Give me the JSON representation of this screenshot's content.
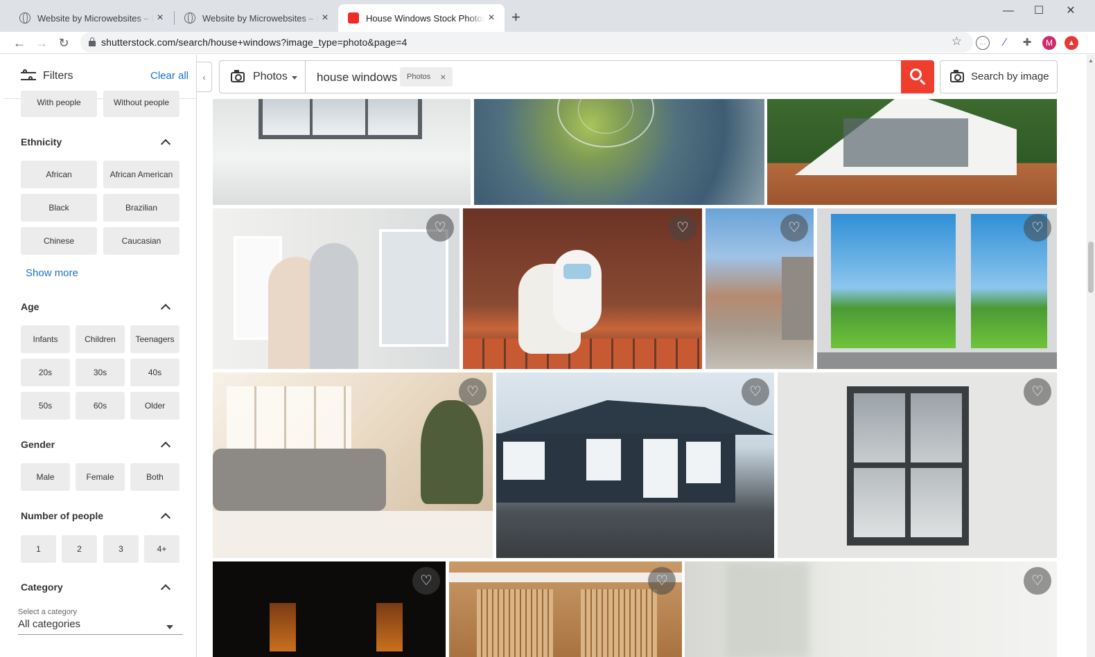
{
  "browser": {
    "tabs": [
      {
        "title": "Website by Microwebsites – Perth",
        "active": false
      },
      {
        "title": "Website by Microwebsites – Perth",
        "active": false
      },
      {
        "title": "House Windows Stock Photos, Images",
        "active": true
      }
    ],
    "url": "shutterstock.com/search/house+windows?image_type=photo&page=4",
    "profile_initial": "M"
  },
  "filters": {
    "label": "Filters",
    "clear_all": "Clear all",
    "people_chips": [
      "With people",
      "Without people"
    ],
    "ethnicity": {
      "title": "Ethnicity",
      "chips": [
        "African",
        "African American",
        "Black",
        "Brazilian",
        "Chinese",
        "Caucasian"
      ],
      "show_more": "Show more"
    },
    "age": {
      "title": "Age",
      "chips": [
        "Infants",
        "Children",
        "Teenagers",
        "20s",
        "30s",
        "40s",
        "50s",
        "60s",
        "Older"
      ]
    },
    "gender": {
      "title": "Gender",
      "chips": [
        "Male",
        "Female",
        "Both"
      ]
    },
    "number_of_people": {
      "title": "Number of people",
      "chips": [
        "1",
        "2",
        "3",
        "4+"
      ]
    },
    "category": {
      "title": "Category",
      "select_label": "Select a category",
      "selected": "All categories"
    }
  },
  "search": {
    "type_label": "Photos",
    "query": "house windows",
    "pill": "Photos",
    "search_by_image": "Search by image"
  },
  "colors": {
    "accent_red": "#ef3e2e",
    "link_blue": "#1a73c8",
    "chip_bg": "#ececec"
  }
}
